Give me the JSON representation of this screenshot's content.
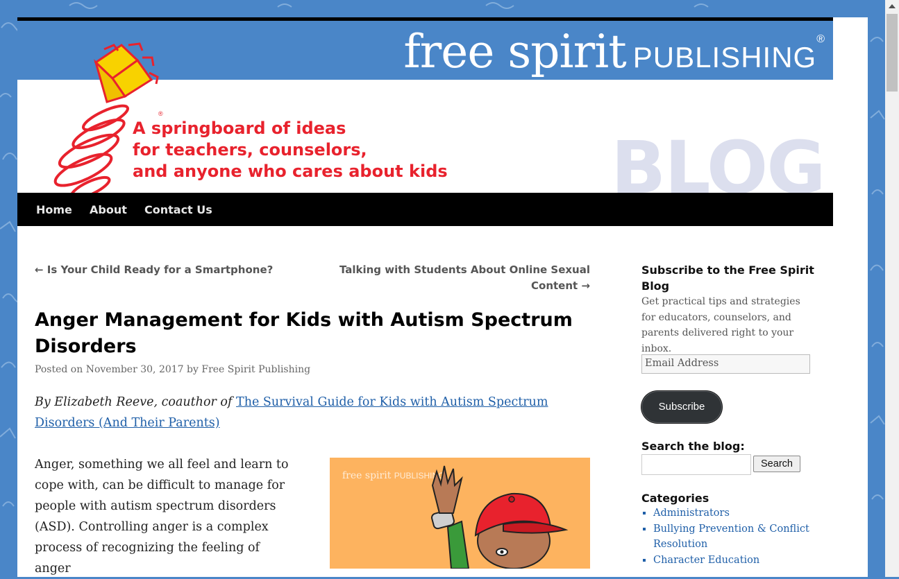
{
  "brand": {
    "name_script": "free spirit",
    "name_caps": "PUBLISHING",
    "registered": "®"
  },
  "tagline": [
    "A springboard of ideas",
    "for teachers, counselors,",
    "and anyone who cares about kids"
  ],
  "blog_word": "BLOG",
  "nav": {
    "items": [
      {
        "label": "Home"
      },
      {
        "label": "About"
      },
      {
        "label": "Contact Us"
      }
    ]
  },
  "post_nav": {
    "prev_label": "← Is Your Child Ready for a Smartphone?",
    "next_label": "Talking with Students About Online Sexual Content →"
  },
  "post": {
    "title": "Anger Management for Kids with Autism Spectrum Disorders",
    "meta_posted_on": "Posted on",
    "date": "November 30, 2017",
    "meta_by": "by",
    "author": "Free Spirit Publishing",
    "byline_prefix": "By Elizabeth Reeve, coauthor of",
    "book_link": "The Survival Guide for Kids with Autism Spectrum Disorders (And Their Parents)",
    "body": "Anger, something we all feel and learn to cope with, can be difficult to manage for people with autism spectrum disorders (ASD). Controlling anger is a complex process of recognizing the feeling of anger",
    "image_watermark_script": "free spirit",
    "image_watermark_caps": "PUBLISHING"
  },
  "sidebar": {
    "subscribe_heading": "Subscribe to the Free Spirit Blog",
    "subscribe_text": "Get practical tips and strategies for educators, counselors, and parents delivered right to your inbox.",
    "email_placeholder": "Email Address",
    "subscribe_button": "Subscribe",
    "search_heading": "Search the blog:",
    "search_button": "Search",
    "categories_heading": "Categories",
    "categories": [
      "Administrators",
      "Bullying Prevention & Conflict Resolution",
      "Character Education"
    ]
  },
  "colors": {
    "background": "#4a86c8",
    "tagline_red": "#e8222d",
    "link_blue": "#1f5fa8",
    "nav_black": "#000000"
  }
}
